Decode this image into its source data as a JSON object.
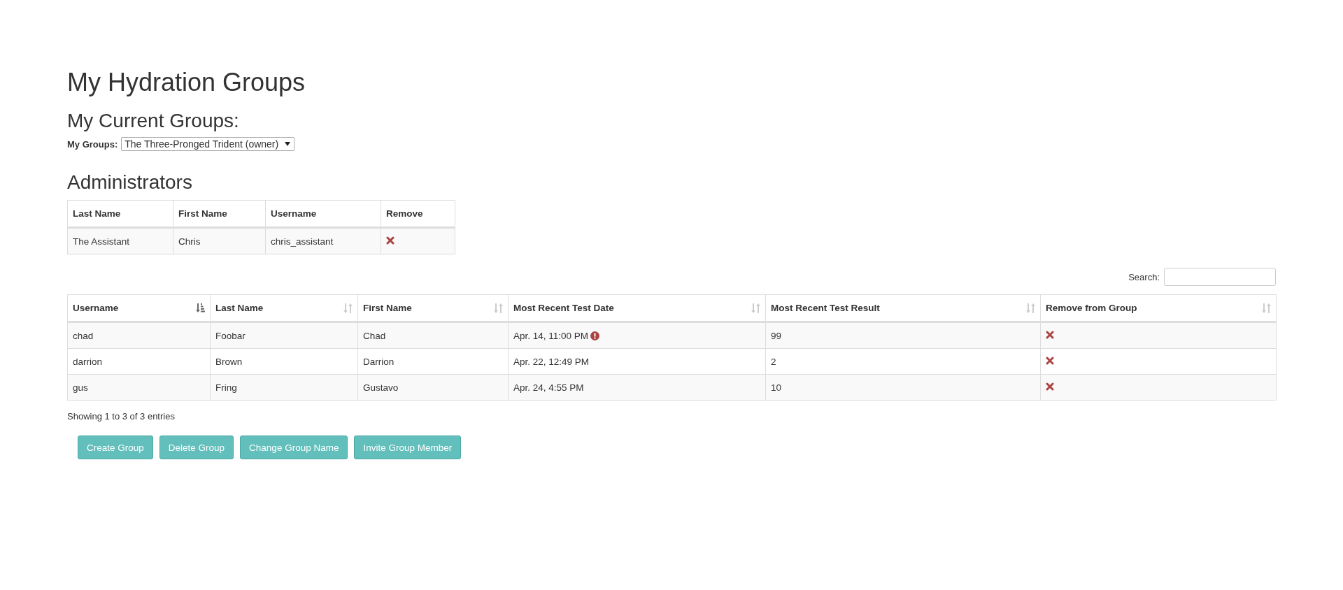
{
  "title": "My Hydration Groups",
  "current_groups": {
    "heading": "My Current Groups:",
    "label": "My Groups:",
    "value": "The Three-Pronged Trident (owner)"
  },
  "administrators": {
    "heading": "Administrators",
    "columns": [
      "Last Name",
      "First Name",
      "Username",
      "Remove"
    ],
    "rows": [
      {
        "last_name": "The Assistant",
        "first_name": "Chris",
        "username": "chris_assistant"
      }
    ]
  },
  "members": {
    "search": {
      "label": "Search:"
    },
    "columns": [
      {
        "label": "Username",
        "sorted": true
      },
      {
        "label": "Last Name",
        "sorted": false
      },
      {
        "label": "First Name",
        "sorted": false
      },
      {
        "label": "Most Recent Test Date",
        "sorted": false
      },
      {
        "label": "Most Recent Test Result",
        "sorted": false
      },
      {
        "label": "Remove from Group",
        "sorted": false
      }
    ],
    "rows": [
      {
        "username": "chad",
        "last_name": "Foobar",
        "first_name": "Chad",
        "test_date": "Apr. 14, 11:00 PM",
        "warning": true,
        "test_result": "99"
      },
      {
        "username": "darrion",
        "last_name": "Brown",
        "first_name": "Darrion",
        "test_date": "Apr. 22, 12:49 PM",
        "warning": false,
        "test_result": "2"
      },
      {
        "username": "gus",
        "last_name": "Fring",
        "first_name": "Gustavo",
        "test_date": "Apr. 24, 4:55 PM",
        "warning": false,
        "test_result": "10"
      }
    ],
    "info": "Showing 1 to 3 of 3 entries"
  },
  "buttons": [
    "Create Group",
    "Delete Group",
    "Change Group Name",
    "Invite Group Member"
  ]
}
